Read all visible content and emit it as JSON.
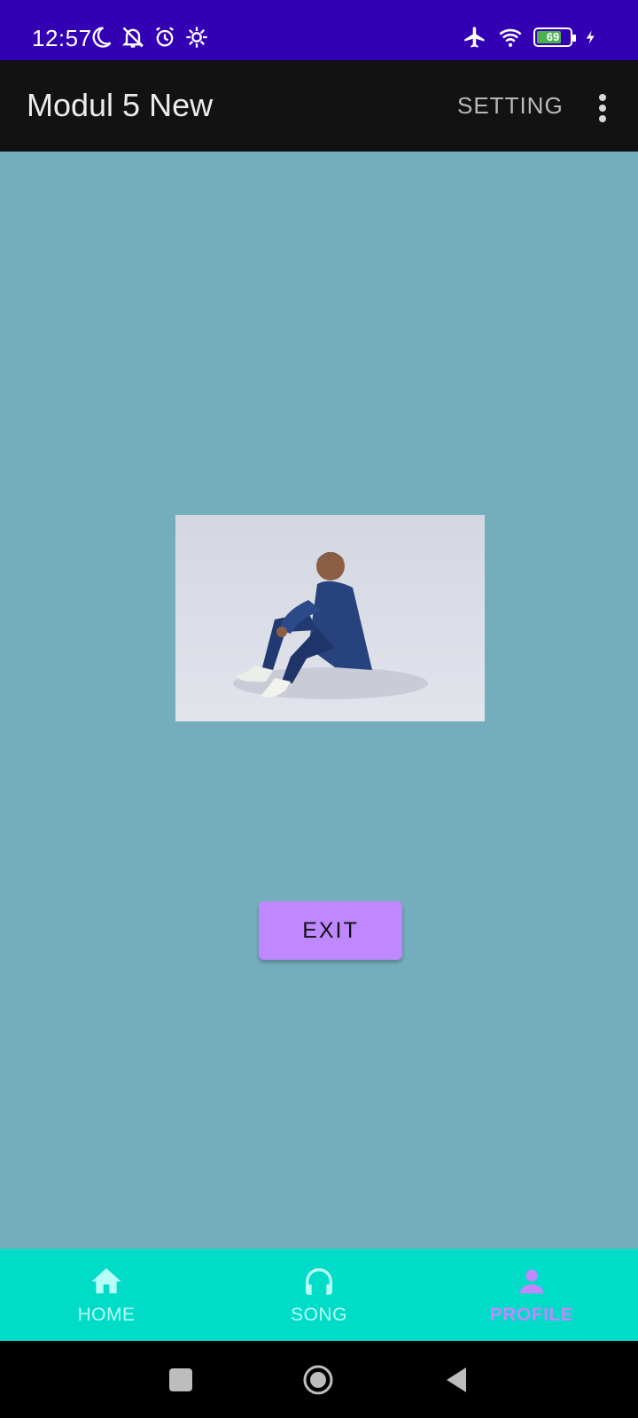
{
  "status_bar": {
    "time": "12:57",
    "battery_level": "69",
    "left_icons": [
      "moon-icon",
      "notifications-off-icon",
      "alarm-icon",
      "settings-gear-icon"
    ],
    "right_icons": [
      "airplane-mode-icon",
      "wifi-icon",
      "battery-icon",
      "charging-bolt-icon"
    ]
  },
  "app_bar": {
    "title": "Modul 5 New",
    "action_label": "SETTING",
    "overflow_icon": "more-vert-icon"
  },
  "main": {
    "photo_icon": "profile-photo-image",
    "exit_label": "EXIT"
  },
  "bottom_nav": {
    "items": [
      {
        "label": "HOME",
        "icon": "home-icon",
        "active": false
      },
      {
        "label": "SONG",
        "icon": "headphones-icon",
        "active": false
      },
      {
        "label": "PROFILE",
        "icon": "person-icon",
        "active": true
      }
    ],
    "active_color": "#bf88ff",
    "inactive_color": "#b6fff6"
  },
  "colors": {
    "status_bar": "#3400b4",
    "app_bar": "#121212",
    "background": "#74aebc",
    "bottom_nav": "#00dcc8",
    "exit_button": "#bf88ff"
  }
}
